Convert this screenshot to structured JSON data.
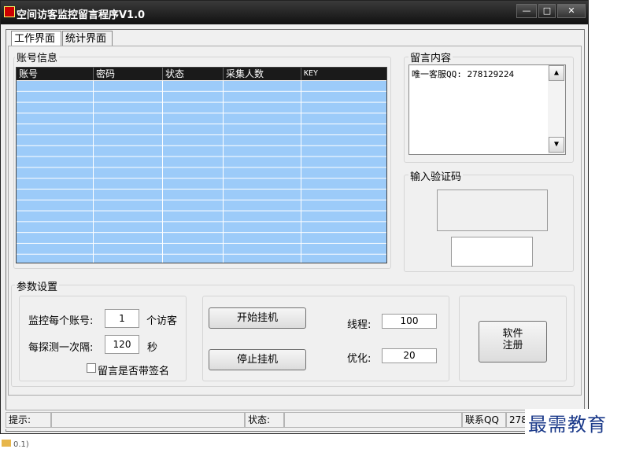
{
  "window": {
    "title": "空间访客监控留言程序V1.0",
    "controls": {
      "minimize": "—",
      "maximize": "□",
      "close": "✕"
    }
  },
  "tabs": [
    "工作界面",
    "统计界面"
  ],
  "account_panel": {
    "title": "账号信息",
    "columns": [
      "账号",
      "密码",
      "状态",
      "采集人数",
      "KEY"
    ],
    "rows": []
  },
  "message_panel": {
    "title": "留言内容",
    "text": "唯一客服QQ: 278129224",
    "scroll_up": "▲",
    "scroll_down": "▼"
  },
  "captcha_panel": {
    "title": "输入验证码",
    "input_value": ""
  },
  "settings": {
    "title": "参数设置",
    "monitor_label": "监控每个账号:",
    "monitor_value": "1",
    "monitor_unit": "个访客",
    "interval_label": "每探测一次隔:",
    "interval_value": "120",
    "interval_unit": "秒",
    "signature_label": "留言是否带签名",
    "signature_checked": false,
    "start_button": "开始挂机",
    "stop_button": "停止挂机",
    "threads_label": "线程:",
    "threads_value": "100",
    "optimize_label": "优化:",
    "optimize_value": "20",
    "register_line1": "软件",
    "register_line2": "注册"
  },
  "status_bar": {
    "hint_label": "提示:",
    "hint_value": "",
    "state_label": "状态:",
    "state_value": "",
    "contact_label": "联系QQ",
    "contact_value": "278"
  },
  "watermark": "最需教育",
  "taskbar_fragment": "0.1)"
}
